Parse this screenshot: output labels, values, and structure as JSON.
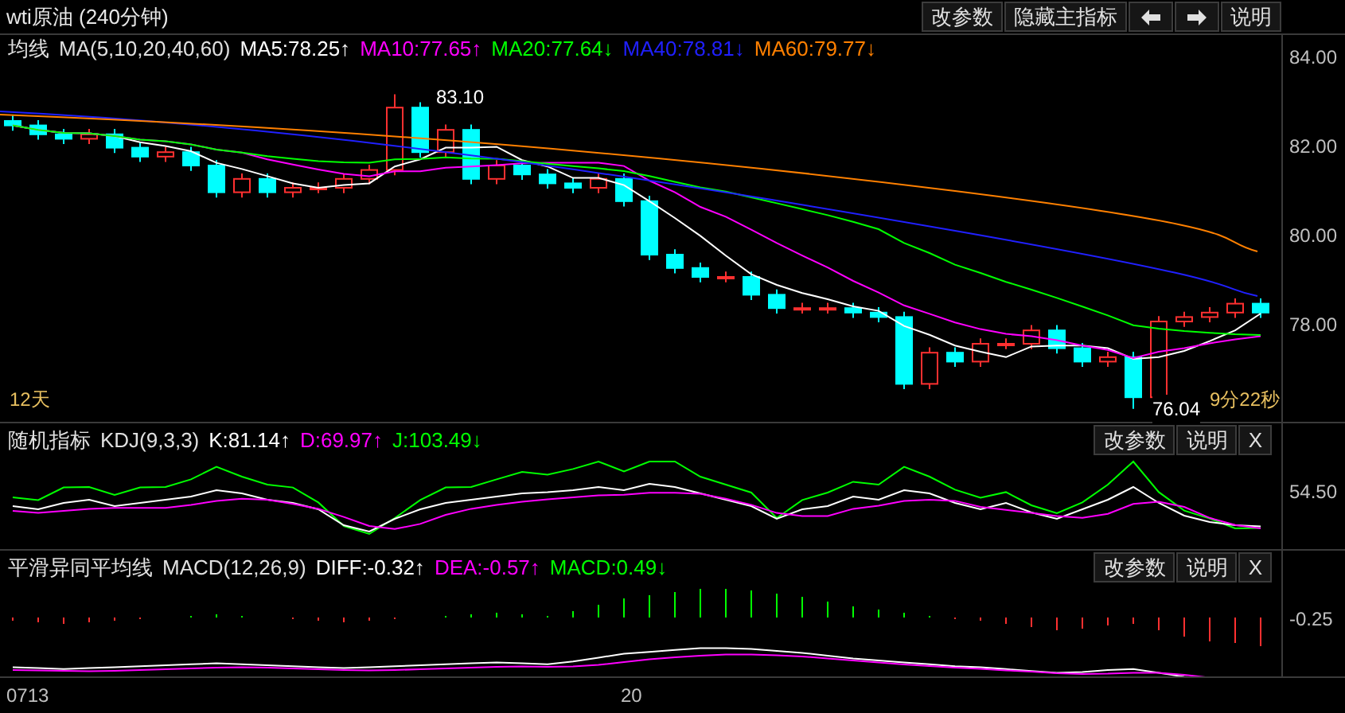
{
  "window": {
    "title": "wti原油 (240分钟)"
  },
  "main_buttons": [
    {
      "kind": "text",
      "label": "改参数"
    },
    {
      "kind": "text",
      "label": "隐藏主指标"
    },
    {
      "kind": "left"
    },
    {
      "kind": "right"
    },
    {
      "kind": "text",
      "label": "说明"
    }
  ],
  "main_pane": {
    "indicator": "均线",
    "params": "MA(5,10,20,40,60)",
    "items": [
      {
        "label": "MA5:78.25↑",
        "color": "#ffffff"
      },
      {
        "label": "MA10:77.65↑",
        "color": "#ff00ff"
      },
      {
        "label": "MA20:77.64↓",
        "color": "#00ff00"
      },
      {
        "label": "MA40:78.81↓",
        "color": "#2020ff"
      },
      {
        "label": "MA60:79.77↓",
        "color": "#ff8000"
      }
    ],
    "y_axis": [
      "84.00",
      "82.00",
      "80.00",
      "78.00"
    ],
    "high_label": "83.10",
    "low_label": "76.04",
    "period_label": "12天",
    "countdown": "9分22秒"
  },
  "kdj_pane": {
    "indicator": "随机指标",
    "params": "KDJ(9,3,3)",
    "items": [
      {
        "label": "K:81.14↑",
        "color": "#ffffff"
      },
      {
        "label": "D:69.97↑",
        "color": "#ff00ff"
      },
      {
        "label": "J:103.49↓",
        "color": "#00ff00"
      }
    ],
    "buttons": [
      "改参数",
      "说明",
      "X"
    ],
    "y_axis": [
      "54.50"
    ]
  },
  "macd_pane": {
    "indicator": "平滑异同平均线",
    "params": "MACD(12,26,9)",
    "items": [
      {
        "label": "DIFF:-0.32↑",
        "color": "#ffffff"
      },
      {
        "label": "DEA:-0.57↑",
        "color": "#ff00ff"
      },
      {
        "label": "MACD:0.49↓",
        "color": "#00ff00"
      }
    ],
    "buttons": [
      "改参数",
      "说明",
      "X"
    ],
    "y_axis": [
      "-0.25"
    ]
  },
  "x_axis": [
    "0713",
    "20"
  ]
}
